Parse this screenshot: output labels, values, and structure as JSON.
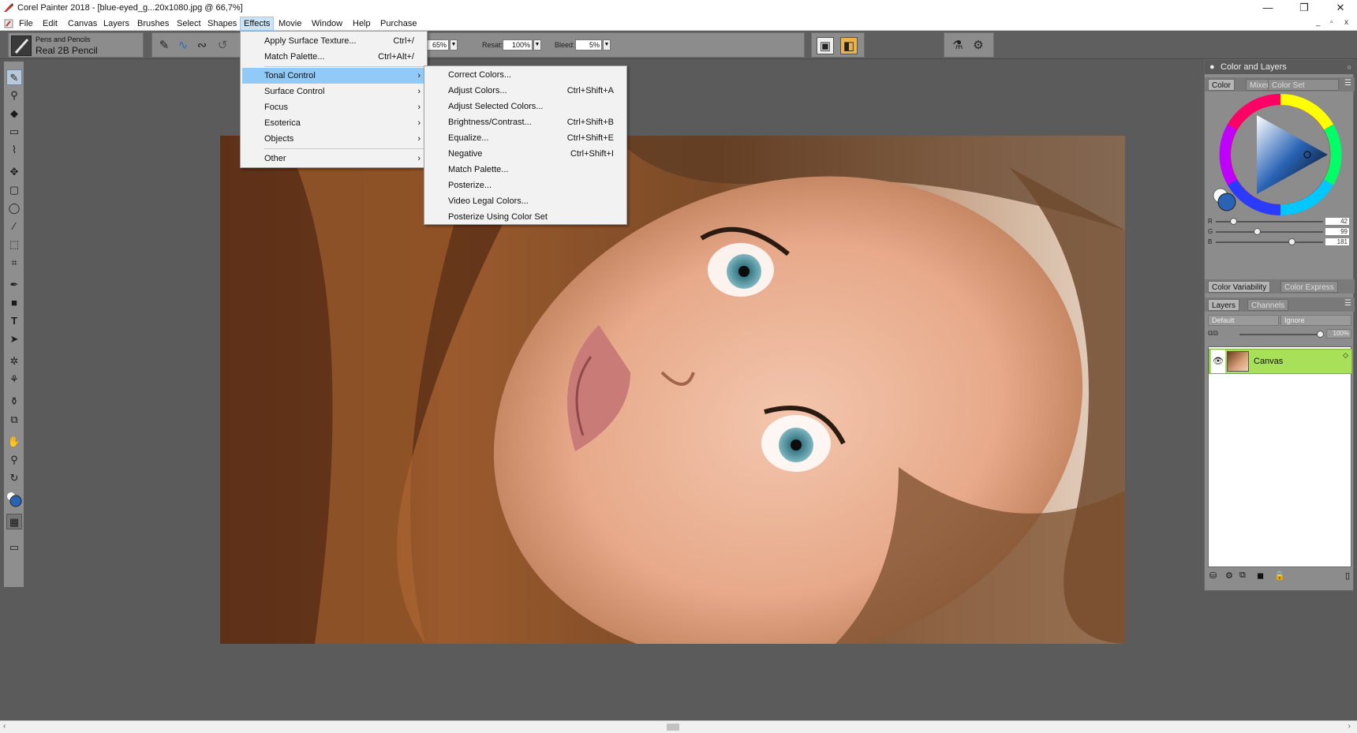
{
  "window": {
    "title": "Corel Painter 2018 - [blue-eyed_g...20x1080.jpg @ 66,7%]",
    "minimize_glyph": "—",
    "maximize_glyph": "❐",
    "close_glyph": "✕",
    "mdi_minimize": "_",
    "mdi_restore": "▫",
    "mdi_close": "x"
  },
  "menubar": [
    "File",
    "Edit",
    "Canvas",
    "Layers",
    "Brushes",
    "Select",
    "Shapes",
    "Effects",
    "Movie",
    "Window",
    "Help",
    "Purchase"
  ],
  "active_menu": "Effects",
  "property_bar": {
    "brush_category": "Pens and Pencils",
    "brush_variant": "Real 2B Pencil",
    "opacity_value": "65%",
    "resat_label": "Resat:",
    "resat_value": "100%",
    "bleed_label": "Bleed:",
    "bleed_value": "5%",
    "dropdown_glyph": "▼"
  },
  "effects_menu": {
    "items": [
      {
        "label": "Apply Surface Texture...",
        "shortcut": "Ctrl+/"
      },
      {
        "label": "Match Palette...",
        "shortcut": "Ctrl+Alt+/"
      }
    ],
    "submenus": [
      "Tonal Control",
      "Surface Control",
      "Focus",
      "Esoterica",
      "Objects",
      "Other"
    ],
    "highlighted": "Tonal Control",
    "arrow_glyph": "›"
  },
  "tonal_control_menu": {
    "items": [
      {
        "label": "Correct Colors...",
        "shortcut": ""
      },
      {
        "label": "Adjust Colors...",
        "shortcut": "Ctrl+Shift+A"
      },
      {
        "label": "Adjust Selected Colors...",
        "shortcut": ""
      },
      {
        "label": "Brightness/Contrast...",
        "shortcut": "Ctrl+Shift+B"
      },
      {
        "label": "Equalize...",
        "shortcut": "Ctrl+Shift+E"
      },
      {
        "label": "Negative",
        "shortcut": "Ctrl+Shift+I"
      },
      {
        "label": "Match Palette...",
        "shortcut": ""
      },
      {
        "label": "Posterize...",
        "shortcut": ""
      },
      {
        "label": "Video Legal Colors...",
        "shortcut": ""
      },
      {
        "label": "Posterize Using Color Set",
        "shortcut": ""
      }
    ]
  },
  "right_panel": {
    "title": "Color and Layers",
    "color_tabs": [
      "Color",
      "Mixer",
      "Color Set Libraries"
    ],
    "rgb": [
      {
        "channel": "R",
        "value": "42"
      },
      {
        "channel": "G",
        "value": "99"
      },
      {
        "channel": "B",
        "value": "181"
      }
    ],
    "current_color": "#2a63b5",
    "variability_tabs": [
      "Color Variability",
      "Color Express"
    ],
    "layer_tabs": [
      "Layers",
      "Channels"
    ],
    "composite_method": "Default",
    "preserve": "Ignore",
    "opacity": "100%",
    "layers": [
      {
        "name": "Canvas"
      }
    ],
    "layer_color": "#a8e05a"
  },
  "colors": {
    "workspace": "#5b5b5b",
    "menu_highlight": "#91c9f7"
  }
}
